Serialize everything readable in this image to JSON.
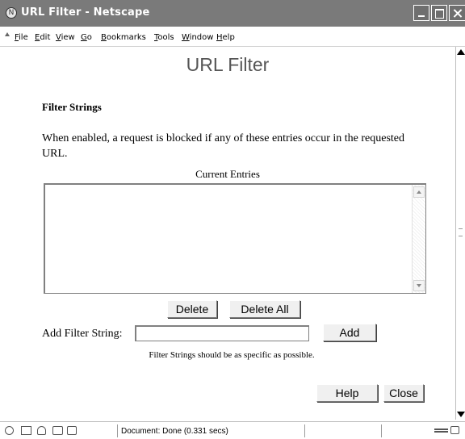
{
  "window": {
    "title": "URL Filter - Netscape",
    "icon": "netscape-icon"
  },
  "menubar": {
    "items": [
      {
        "label": "File",
        "mnemonic": "F"
      },
      {
        "label": "Edit",
        "mnemonic": "E"
      },
      {
        "label": "View",
        "mnemonic": "V"
      },
      {
        "label": "Go",
        "mnemonic": "G"
      },
      {
        "label": "Bookmarks",
        "mnemonic": "B"
      },
      {
        "label": "Tools",
        "mnemonic": "T"
      },
      {
        "label": "Window",
        "mnemonic": "W"
      },
      {
        "label": "Help",
        "mnemonic": "H"
      }
    ]
  },
  "page": {
    "title": "URL Filter",
    "section_title": "Filter Strings",
    "description": "When enabled, a request is blocked if any of these entries occur in the requested URL.",
    "entries_label": "Current Entries",
    "entries": [],
    "delete_label": "Delete",
    "delete_all_label": "Delete All",
    "add_filter_label": "Add Filter String:",
    "add_filter_value": "",
    "add_label": "Add",
    "hint": "Filter Strings should be as specific as possible.",
    "help_label": "Help",
    "close_label": "Close"
  },
  "statusbar": {
    "text": "Document: Done (0.331 secs)",
    "icons": [
      "navigator-icon",
      "mail-icon",
      "address-book-icon",
      "composer-icon",
      "page-icon",
      "network-icon",
      "security-lock-icon"
    ]
  },
  "colors": {
    "titlebar": "#7a7a7a",
    "page_title": "#555555",
    "button_face": "#f0f0f0"
  }
}
